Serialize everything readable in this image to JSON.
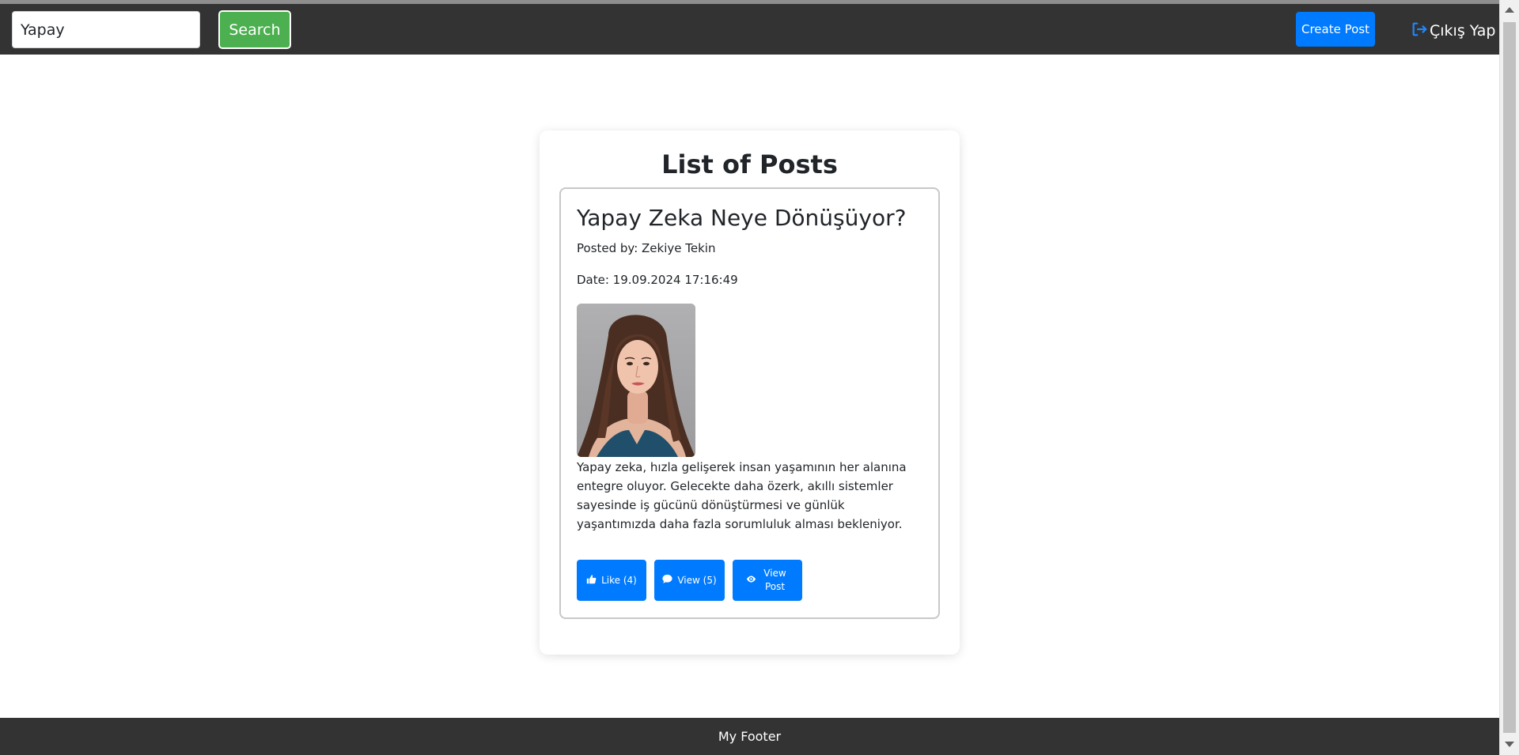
{
  "navbar": {
    "search": {
      "value": "Yapay",
      "placeholder": ""
    },
    "search_label": "Search",
    "create_label": "Create Post",
    "logout_label": "Çıkış Yap",
    "logout_icon": "logout-icon"
  },
  "main": {
    "title": "List of Posts",
    "posts": [
      {
        "title": "Yapay Zeka Neye Dönüşüyor?",
        "author": "Posted by: Zekiye Tekin",
        "date": "Date: 19.09.2024 17:16:49",
        "image": "portrait-photo",
        "body": "Yapay zeka, hızla gelişerek insan yaşamının her alanına entegre oluyor. Gelecekte daha özerk, akıllı sistemler sayesinde iş gücünü dönüştürmesi ve günlük yaşantımızda daha fazla sorumluluk alması bekleniyor.",
        "like_label": "Like (4)",
        "view_label": "View (5)",
        "view_post_label": "View Post"
      }
    ]
  },
  "footer": {
    "text": "My Footer"
  },
  "colors": {
    "navbar_bg": "#333333",
    "search_button": "#4caf50",
    "primary": "#007bff",
    "footer_bg": "#333333"
  }
}
